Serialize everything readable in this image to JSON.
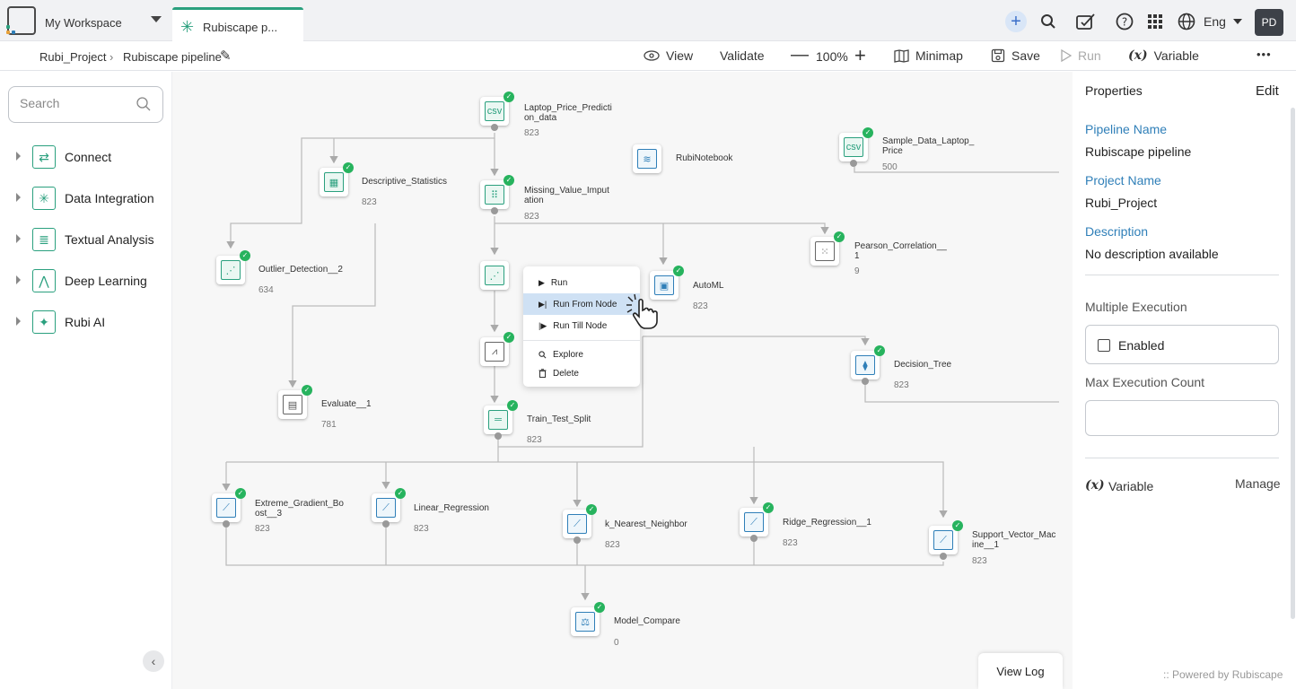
{
  "topbar": {
    "workspace_label": "My Workspace",
    "tab_label": "Rubiscape p...",
    "language": "Eng",
    "avatar_initials": "PD",
    "icons": [
      "plus-icon",
      "search-icon",
      "task-icon",
      "help-icon",
      "apps-grid-icon",
      "globe-icon"
    ]
  },
  "breadcrumb": {
    "project": "Rubi_Project",
    "separator": "›",
    "pipeline": "Rubiscape pipeline"
  },
  "toolbar": {
    "view": "View",
    "validate": "Validate",
    "zoom": "100%",
    "minimap": "Minimap",
    "save": "Save",
    "run": "Run",
    "variable_symbol": "(x)",
    "variable": "Variable",
    "more": "•••"
  },
  "sidebar": {
    "search_placeholder": "Search",
    "items": [
      {
        "label": "Connect",
        "icon": "connect-icon",
        "glyph": "⇄"
      },
      {
        "label": "Data Integration",
        "icon": "data-integration-icon",
        "glyph": "✳"
      },
      {
        "label": "Textual Analysis",
        "icon": "textual-analysis-icon",
        "glyph": "≣"
      },
      {
        "label": "Deep Learning",
        "icon": "deep-learning-icon",
        "glyph": "⋀"
      },
      {
        "label": "Rubi AI",
        "icon": "rubi-ai-icon",
        "glyph": "✦"
      }
    ]
  },
  "nodes": {
    "laptop": {
      "label1": "Laptop_Price_Predicti",
      "label2": "on_data",
      "count": "823",
      "glyph": "csv"
    },
    "sample": {
      "label1": "Sample_Data_Laptop_",
      "label2": "Price",
      "count": "500",
      "glyph": "csv"
    },
    "rubinotebook": {
      "label1": "RubiNotebook",
      "glyph": "≋"
    },
    "descstats": {
      "label1": "Descriptive_Statistics",
      "count": "823",
      "glyph": "▦"
    },
    "missing": {
      "label1": "Missing_Value_Imput",
      "label2": "ation",
      "count": "823",
      "glyph": "⠿"
    },
    "outlier": {
      "label1": "Outlier_Detection__2",
      "count": "634",
      "glyph": "⋰"
    },
    "pearson": {
      "label1": "Pearson_Correlation__",
      "label2": "1",
      "count": "9",
      "glyph": "⁙"
    },
    "hidden1": {
      "glyph": "⋰"
    },
    "automl": {
      "label1": "AutoML",
      "count": "823",
      "glyph": "▣"
    },
    "hidden2": {
      "glyph": "⩘"
    },
    "decision": {
      "label1": "Decision_Tree",
      "count": "823",
      "glyph": "⧫"
    },
    "evaluate": {
      "label1": "Evaluate__1",
      "count": "781",
      "glyph": "▤"
    },
    "traintest": {
      "label1": "Train_Test_Split",
      "count": "823",
      "glyph": "═"
    },
    "xgb": {
      "label1": "Extreme_Gradient_Bo",
      "label2": "ost__3",
      "count": "823",
      "glyph": "⟋"
    },
    "linreg": {
      "label1": "Linear_Regression",
      "count": "823",
      "glyph": "⟋"
    },
    "knn": {
      "label1": "k_Nearest_Neighbor",
      "count": "823",
      "glyph": "⟋"
    },
    "ridge": {
      "label1": "Ridge_Regression__1",
      "count": "823",
      "glyph": "⟋"
    },
    "svm": {
      "label1": "Support_Vector_Mac",
      "label2": "ine__1",
      "count": "823",
      "glyph": "⟋"
    },
    "compare": {
      "label1": "Model_Compare",
      "count": "0",
      "glyph": "⚖"
    }
  },
  "context_menu": {
    "run": "Run",
    "run_from_node": "Run From Node",
    "run_till_node": "Run Till Node",
    "explore": "Explore",
    "delete": "Delete"
  },
  "view_log": "View Log",
  "properties": {
    "title": "Properties",
    "edit": "Edit",
    "pipeline_name_key": "Pipeline Name",
    "pipeline_name": "Rubiscape pipeline",
    "project_name_key": "Project Name",
    "project_name": "Rubi_Project",
    "description_key": "Description",
    "description": "No description available",
    "multiple_execution": "Multiple Execution",
    "enabled": "Enabled",
    "max_execution_count": "Max Execution Count",
    "max_execution_value": "",
    "variable_symbol": "(x)",
    "variable": "Variable",
    "manage": "Manage"
  },
  "footer": ":: Powered by Rubiscape",
  "colors": {
    "accent": "#2aa07e",
    "link": "#2f7fb8",
    "success": "#27b35e",
    "menu_active": "#cfe1f4"
  }
}
